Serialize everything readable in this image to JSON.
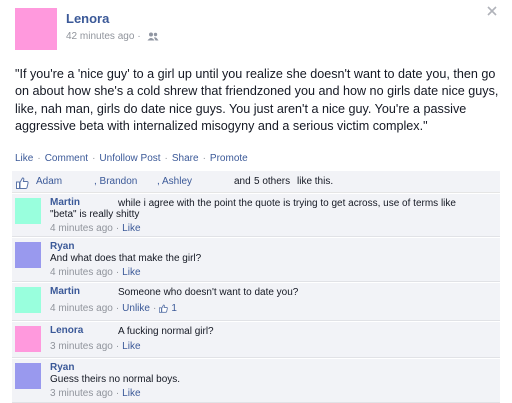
{
  "post": {
    "author": "Lenora",
    "time": "42 minutes ago",
    "separator": "·",
    "audience_icon": "friends-icon",
    "text": "\"If you're a 'nice guy' to a girl up until you realize she doesn't want to date you, then go on about how she's a cold shrew that friendzoned you and how no girls date nice guys, like, nah man, girls do date nice guys. You just aren't a nice guy. You're a passive aggressive beta with internalized misogyny and a serious victim complex.\"",
    "author_avatar_color": "#ff99dd"
  },
  "actions": {
    "like": "Like",
    "comment": "Comment",
    "unfollow": "Unfollow Post",
    "share": "Share",
    "promote": "Promote",
    "separator": "·"
  },
  "likes": {
    "icon": "thumbs-up-icon",
    "person1": "Adam",
    "person2": ", Brandon",
    "person3": ", Ashley",
    "connector": "and",
    "others": "5 others",
    "suffix": "like this."
  },
  "comments": [
    {
      "name": "Martin",
      "text_line1": "while i agree with the point the quote is trying to get across, use of terms like",
      "text_line2": "\"beta\" is really shitty",
      "time": "4 minutes ago",
      "action": "Like",
      "avatar_color": "#99ffdd"
    },
    {
      "name": "Ryan",
      "text_line1": "And what does that make the girl?",
      "time": "4 minutes ago",
      "action": "Like",
      "avatar_color": "#9999ee"
    },
    {
      "name": "Martin",
      "text_line1": "Someone who doesn't want to date you?",
      "time": "4 minutes ago",
      "action": "Unlike",
      "like_count": "1",
      "avatar_color": "#99ffdd"
    },
    {
      "name": "Lenora",
      "text_line1": "A fucking normal girl?",
      "time": "3 minutes ago",
      "action": "Like",
      "avatar_color": "#ff99dd"
    },
    {
      "name": "Ryan",
      "text_line1": "Guess theirs no normal boys.",
      "time": "3 minutes ago",
      "action": "Like",
      "avatar_color": "#9999ee"
    }
  ],
  "colors": {
    "link": "#3b5998",
    "meta": "#90949c",
    "comment_bg": "#f2f3f7"
  }
}
